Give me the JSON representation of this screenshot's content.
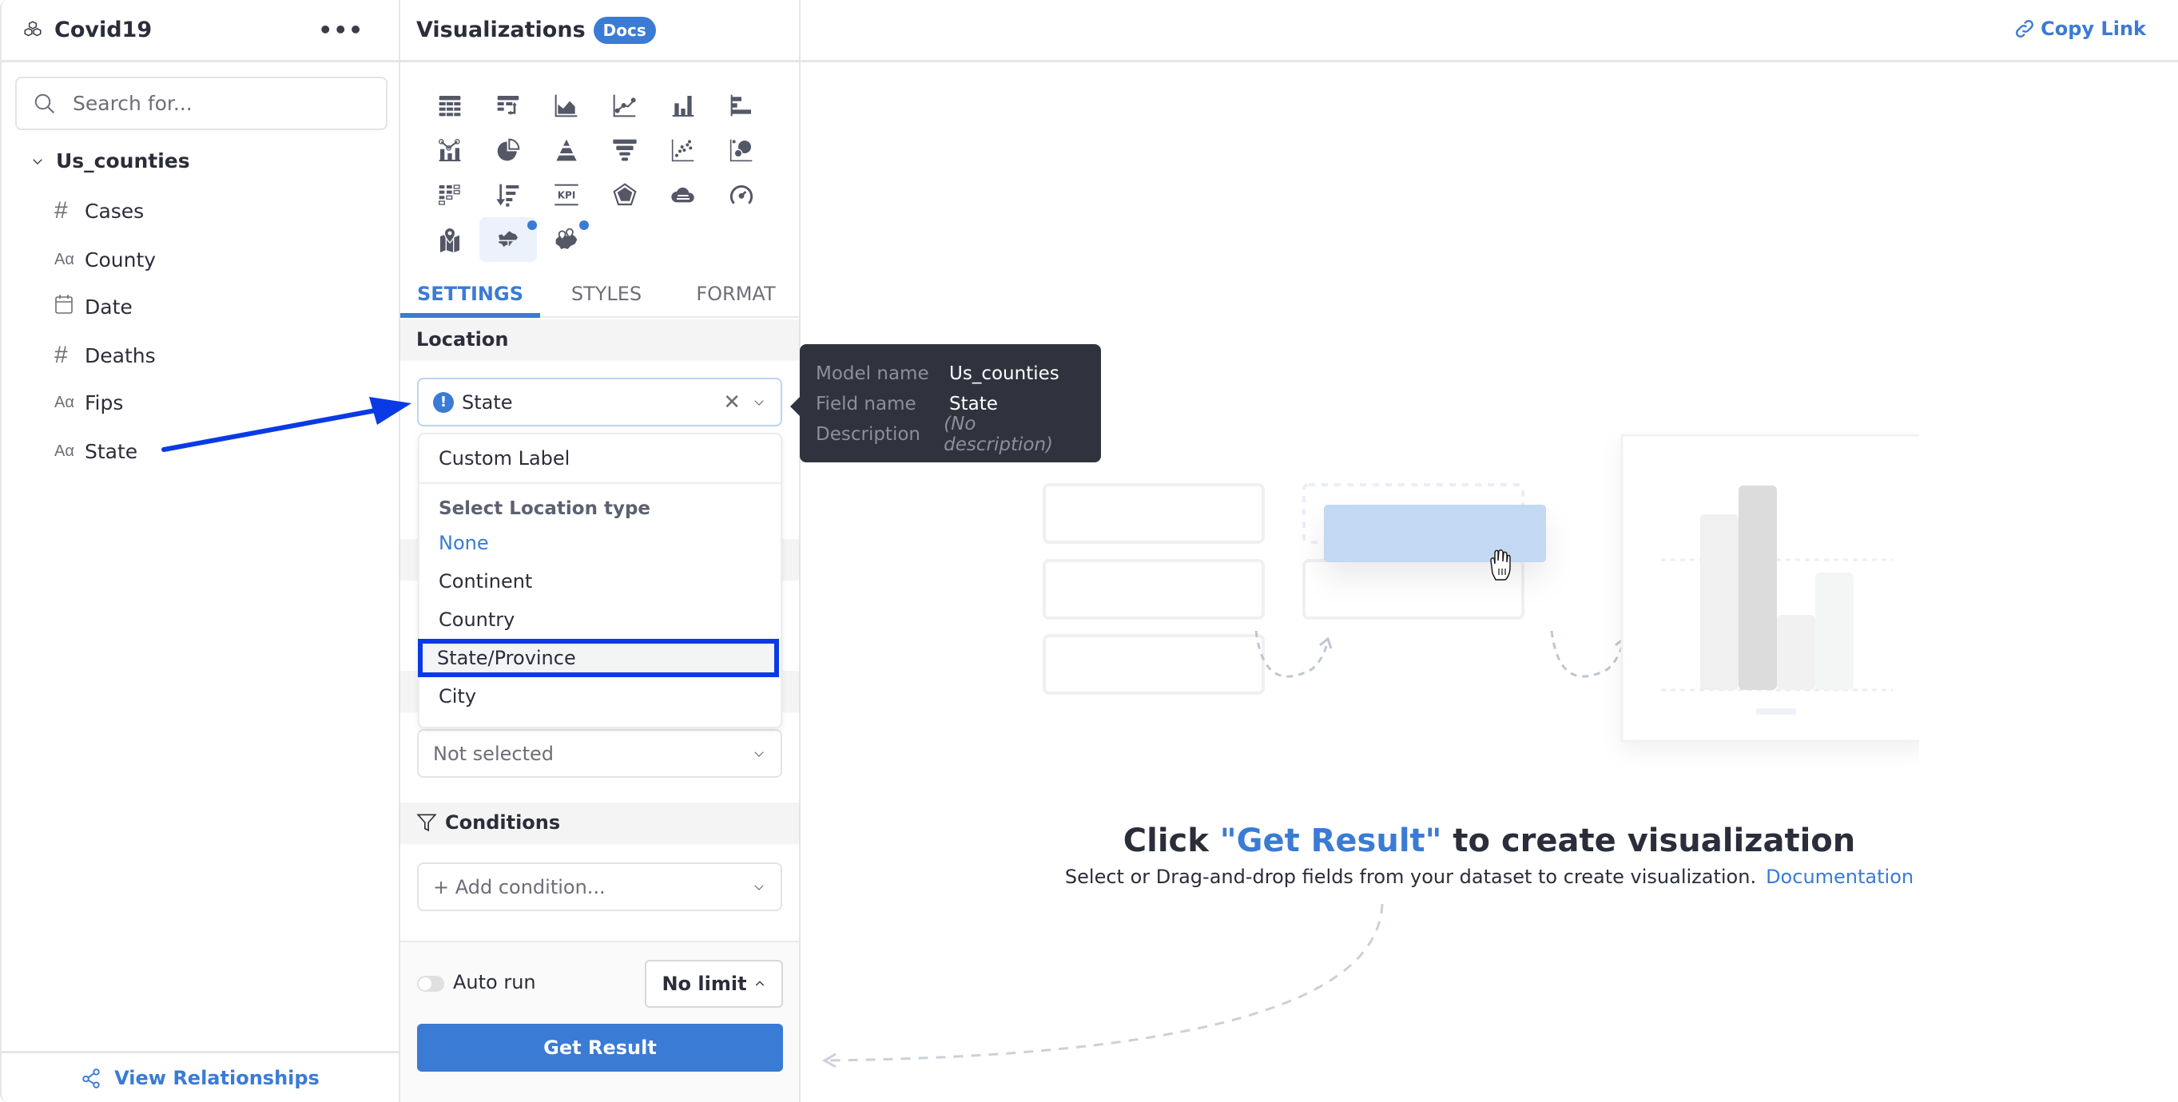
{
  "sidebar": {
    "title": "Covid19",
    "more_label": "•••",
    "search": {
      "placeholder": "Search for...",
      "value": ""
    },
    "model": {
      "name": "Us_counties",
      "expanded": true
    },
    "fields": [
      {
        "type": "number",
        "icon": "hash-icon",
        "glyph": "#",
        "label": "Cases"
      },
      {
        "type": "text",
        "icon": "text-type-icon",
        "glyph": "Aα",
        "label": "County"
      },
      {
        "type": "date",
        "icon": "calendar-icon",
        "glyph": "",
        "label": "Date"
      },
      {
        "type": "number",
        "icon": "hash-icon",
        "glyph": "#",
        "label": "Deaths"
      },
      {
        "type": "text",
        "icon": "text-type-icon",
        "glyph": "Aα",
        "label": "Fips"
      },
      {
        "type": "text",
        "icon": "text-type-icon",
        "glyph": "Aα",
        "label": "State"
      }
    ],
    "footer_link": "View Relationships"
  },
  "viz_panel": {
    "title": "Visualizations",
    "docs_badge": "Docs",
    "chart_types": [
      "data-table",
      "pivot-table",
      "area-chart",
      "line-chart",
      "column-chart",
      "bar-chart",
      "combination-chart",
      "pie-chart",
      "pyramid-chart",
      "funnel-chart",
      "scatter-chart",
      "bubble-chart",
      "conditional-table",
      "sorted-bar",
      "kpi-metric",
      "radar-chart",
      "word-cloud",
      "gauge-chart",
      "point-map",
      "filled-map",
      "heat-map"
    ],
    "active_chart_type": "filled-map",
    "new_badges": [
      "filled-map",
      "heat-map"
    ],
    "kpi_label": "KPI",
    "tabs": [
      {
        "label": "SETTINGS",
        "active": true
      },
      {
        "label": "STYLES",
        "active": false
      },
      {
        "label": "FORMAT",
        "active": false
      }
    ],
    "location": {
      "section_label": "Location",
      "selected_field": "State",
      "dropdown": {
        "custom_label": "Custom Label",
        "group_label": "Select Location type",
        "options": [
          {
            "label": "None",
            "selected": true,
            "hovered": false
          },
          {
            "label": "Continent",
            "selected": false,
            "hovered": false
          },
          {
            "label": "Country",
            "selected": false,
            "hovered": false
          },
          {
            "label": "State/Province",
            "selected": false,
            "hovered": true
          },
          {
            "label": "City",
            "selected": false,
            "hovered": false
          }
        ]
      }
    },
    "second_select": {
      "placeholder": "Not selected"
    },
    "conditions": {
      "section_label": "Conditions",
      "add_placeholder": "+ Add condition..."
    },
    "footer": {
      "auto_run_label": "Auto run",
      "auto_run_on": false,
      "limit_label": "No limit",
      "get_result_label": "Get Result"
    }
  },
  "tooltip": {
    "rows": [
      {
        "key": "Model name",
        "value": "Us_counties"
      },
      {
        "key": "Field name",
        "value": "State"
      },
      {
        "key": "Description",
        "value": "(No description)"
      }
    ]
  },
  "main": {
    "copy_link_label": "Copy Link",
    "headline_prefix": "Click ",
    "headline_highlight": "\"Get Result\"",
    "headline_suffix": " to create visualization",
    "subline": "Select or Drag-and-drop fields from your dataset to create visualization.",
    "documentation_link": "Documentation"
  },
  "colors": {
    "accent": "#3a7bd5",
    "text": "#2b2d3a",
    "muted": "#6d6e78",
    "tooltip_bg": "#30333d",
    "annotation": "#0a3ae6"
  }
}
